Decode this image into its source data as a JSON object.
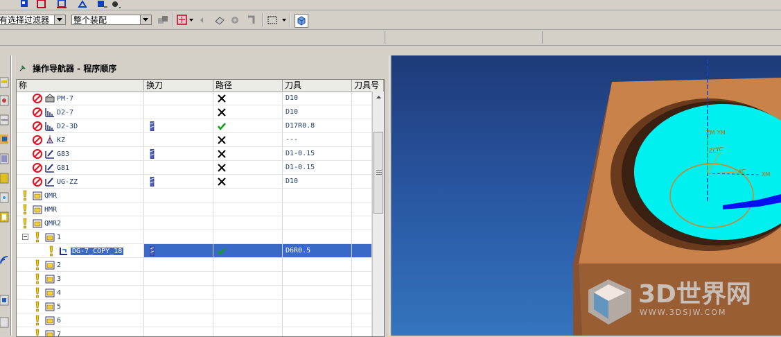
{
  "filter": {
    "selection_filter_value": "有选择过滤器",
    "assembly_value": "整个装配"
  },
  "navigator": {
    "title": "操作导航器 - 程序顺序",
    "columns": [
      "称",
      "换刀",
      "路径",
      "刀具",
      "刀具号"
    ],
    "rows": [
      {
        "name": "PM-7",
        "tool_change": false,
        "path": "x",
        "tool": "D10",
        "kind": "op-mill",
        "status": "forbidden",
        "indent": 1
      },
      {
        "name": "D2-7",
        "tool_change": false,
        "path": "x",
        "tool": "D10",
        "kind": "op-contour",
        "status": "forbidden",
        "indent": 1
      },
      {
        "name": "D2-3D",
        "tool_change": true,
        "path": "check",
        "tool": "D17R0.8",
        "kind": "op-contour",
        "status": "forbidden",
        "indent": 1
      },
      {
        "name": "KZ",
        "tool_change": false,
        "path": "x",
        "tool": "---",
        "kind": "op-drill",
        "status": "forbidden",
        "indent": 1
      },
      {
        "name": "G83",
        "tool_change": true,
        "path": "x",
        "tool": "D1-0.15",
        "kind": "op-engrave",
        "status": "forbidden",
        "indent": 1
      },
      {
        "name": "G81",
        "tool_change": false,
        "path": "x",
        "tool": "D1-0.15",
        "kind": "op-engrave",
        "status": "forbidden",
        "indent": 1
      },
      {
        "name": "UG-ZZ",
        "tool_change": true,
        "path": "x",
        "tool": "D10",
        "kind": "op-engrave",
        "status": "forbidden",
        "indent": 1
      },
      {
        "name": "QMR",
        "tool_change": false,
        "path": "",
        "tool": "",
        "kind": "group",
        "status": "warn",
        "indent": 0
      },
      {
        "name": "HMR",
        "tool_change": false,
        "path": "",
        "tool": "",
        "kind": "group",
        "status": "warn",
        "indent": 0
      },
      {
        "name": "QMR2",
        "tool_change": false,
        "path": "",
        "tool": "",
        "kind": "group",
        "status": "warn",
        "indent": 0
      },
      {
        "name": "1",
        "tool_change": false,
        "path": "",
        "tool": "",
        "kind": "group",
        "status": "warn",
        "indent": 1,
        "expanded": true
      },
      {
        "name": "DG-7_COPY_18",
        "tool_change": true,
        "path": "check",
        "tool": "D6R0.5",
        "kind": "op-zlevel",
        "status": "warn",
        "indent": 2,
        "selected": true
      },
      {
        "name": "2",
        "tool_change": false,
        "path": "",
        "tool": "",
        "kind": "group",
        "status": "warn",
        "indent": 1
      },
      {
        "name": "3",
        "tool_change": false,
        "path": "",
        "tool": "",
        "kind": "group",
        "status": "warn",
        "indent": 1
      },
      {
        "name": "4",
        "tool_change": false,
        "path": "",
        "tool": "",
        "kind": "group",
        "status": "warn",
        "indent": 1
      },
      {
        "name": "5",
        "tool_change": false,
        "path": "",
        "tool": "",
        "kind": "group",
        "status": "warn",
        "indent": 1
      },
      {
        "name": "6",
        "tool_change": false,
        "path": "",
        "tool": "",
        "kind": "group",
        "status": "warn",
        "indent": 1
      },
      {
        "name": "7",
        "tool_change": false,
        "path": "",
        "tool": "",
        "kind": "group",
        "status": "warn",
        "indent": 1
      }
    ]
  },
  "viewport": {
    "axis_labels": {
      "zm": "ZM",
      "ym": "YM",
      "zc": "ZC",
      "yc": "YC",
      "xc": "XC",
      "xm": "XM"
    },
    "watermark_title": "3D世界网",
    "watermark_url": "WWW.3DSJW.COM",
    "colors": {
      "block": "#c8824a",
      "floor": "#00f0f0",
      "bg_top": "#1e3a78",
      "bg_bottom": "#3474be"
    }
  },
  "icons": {
    "forbidden": "no-entry-icon",
    "warn": "exclamation-icon",
    "path_x": "x-mark-icon",
    "path_check": "check-mark-icon",
    "tool_change": "tool-change-icon"
  }
}
